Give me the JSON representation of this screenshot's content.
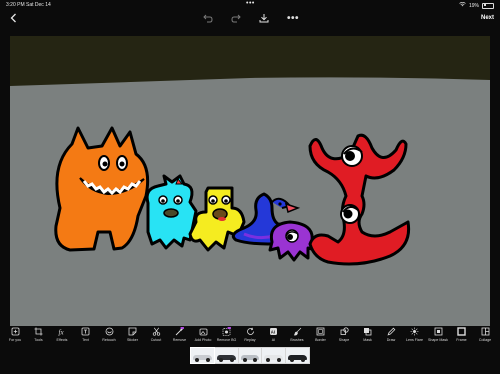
{
  "status": {
    "time": "3:20 PM",
    "date": "Sat Dec 14",
    "dots": "•••",
    "battery": "19%"
  },
  "topbar": {
    "back_icon": "chevron-left-icon",
    "undo_icon": "undo-icon",
    "redo_icon": "redo-icon",
    "save_icon": "download-icon",
    "more_label": "•••",
    "next_label": "Next"
  },
  "canvas": {
    "sky_color": "#252513",
    "ground_color": "#7b807f",
    "characters": [
      "orange-cat-monster",
      "cyan-monster",
      "yellow-monster",
      "blue-bird",
      "purple-creature",
      "red-one-eyed-monster"
    ]
  },
  "toolbar": {
    "items": [
      {
        "label": "For you",
        "icon": "square-plus-icon"
      },
      {
        "label": "Tools",
        "icon": "crop-icon"
      },
      {
        "label": "Effects",
        "icon": "fx-icon"
      },
      {
        "label": "Text",
        "icon": "text-icon"
      },
      {
        "label": "Retouch",
        "icon": "retouch-icon"
      },
      {
        "label": "Sticker",
        "icon": "sticker-icon"
      },
      {
        "label": "Cutout",
        "icon": "scissors-icon"
      },
      {
        "label": "Remove",
        "icon": "magic-wand-icon",
        "badge": "AI"
      },
      {
        "label": "Add Photo",
        "icon": "add-photo-icon"
      },
      {
        "label": "Remove BG",
        "icon": "remove-bg-icon",
        "badge": "AI"
      },
      {
        "label": "Replay",
        "icon": "replay-icon"
      },
      {
        "label": "AI",
        "icon": "ai-icon"
      },
      {
        "label": "Brushes",
        "icon": "brush-icon"
      },
      {
        "label": "Border",
        "icon": "border-icon"
      },
      {
        "label": "Shape",
        "icon": "shape-icon"
      },
      {
        "label": "Mask",
        "icon": "mask-icon"
      },
      {
        "label": "Draw",
        "icon": "pencil-icon"
      },
      {
        "label": "Lens Flare",
        "icon": "lens-flare-icon"
      },
      {
        "label": "Shape Mask",
        "icon": "shape-mask-icon"
      },
      {
        "label": "Frame",
        "icon": "frame-icon"
      },
      {
        "label": "Collage",
        "icon": "collage-icon"
      }
    ]
  },
  "filmstrip": {
    "thumbs": [
      {
        "car_color": "#c9ccd1",
        "active": true
      },
      {
        "car_color": "#2e3136",
        "active": false
      },
      {
        "car_color": "#b9bec4",
        "active": false
      },
      {
        "car_color": "#e4e6e8",
        "active": false
      },
      {
        "car_color": "#1e2024",
        "active": false
      }
    ]
  }
}
